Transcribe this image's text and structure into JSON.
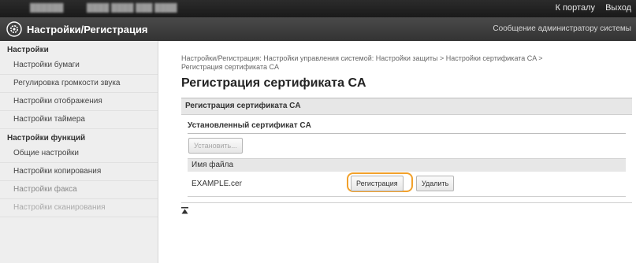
{
  "topbar": {
    "blurred_left": "██████",
    "blurred_mid": "████ ████ ███ ████",
    "to_portal": "К порталу",
    "logout": "Выход"
  },
  "header": {
    "title": "Настройки/Регистрация",
    "admin_message": "Сообщение администратору системы"
  },
  "sidebar": {
    "group1": "Настройки",
    "items1": [
      "Настройки бумаги",
      "Регулировка громкости звука",
      "Настройки отображения",
      "Настройки таймера"
    ],
    "group2": "Настройки функций",
    "items2": [
      "Общие настройки",
      "Настройки копирования",
      "Настройки факса",
      "Настройки сканирования"
    ]
  },
  "main": {
    "breadcrumb_line1": "Настройки/Регистрация: Настройки управления системой: Настройки защиты > Настройки сертификата CA >",
    "breadcrumb_line2": "Регистрация сертификата CA",
    "page_title": "Регистрация сертификата CA",
    "section_title": "Регистрация сертификата CA",
    "installed_title": "Установленный сертификат CA",
    "install_button": "Установить...",
    "column_filename": "Имя файла",
    "file_name": "EXAMPLE.cer",
    "register_button": "Регистрация",
    "delete_button": "Удалить"
  }
}
